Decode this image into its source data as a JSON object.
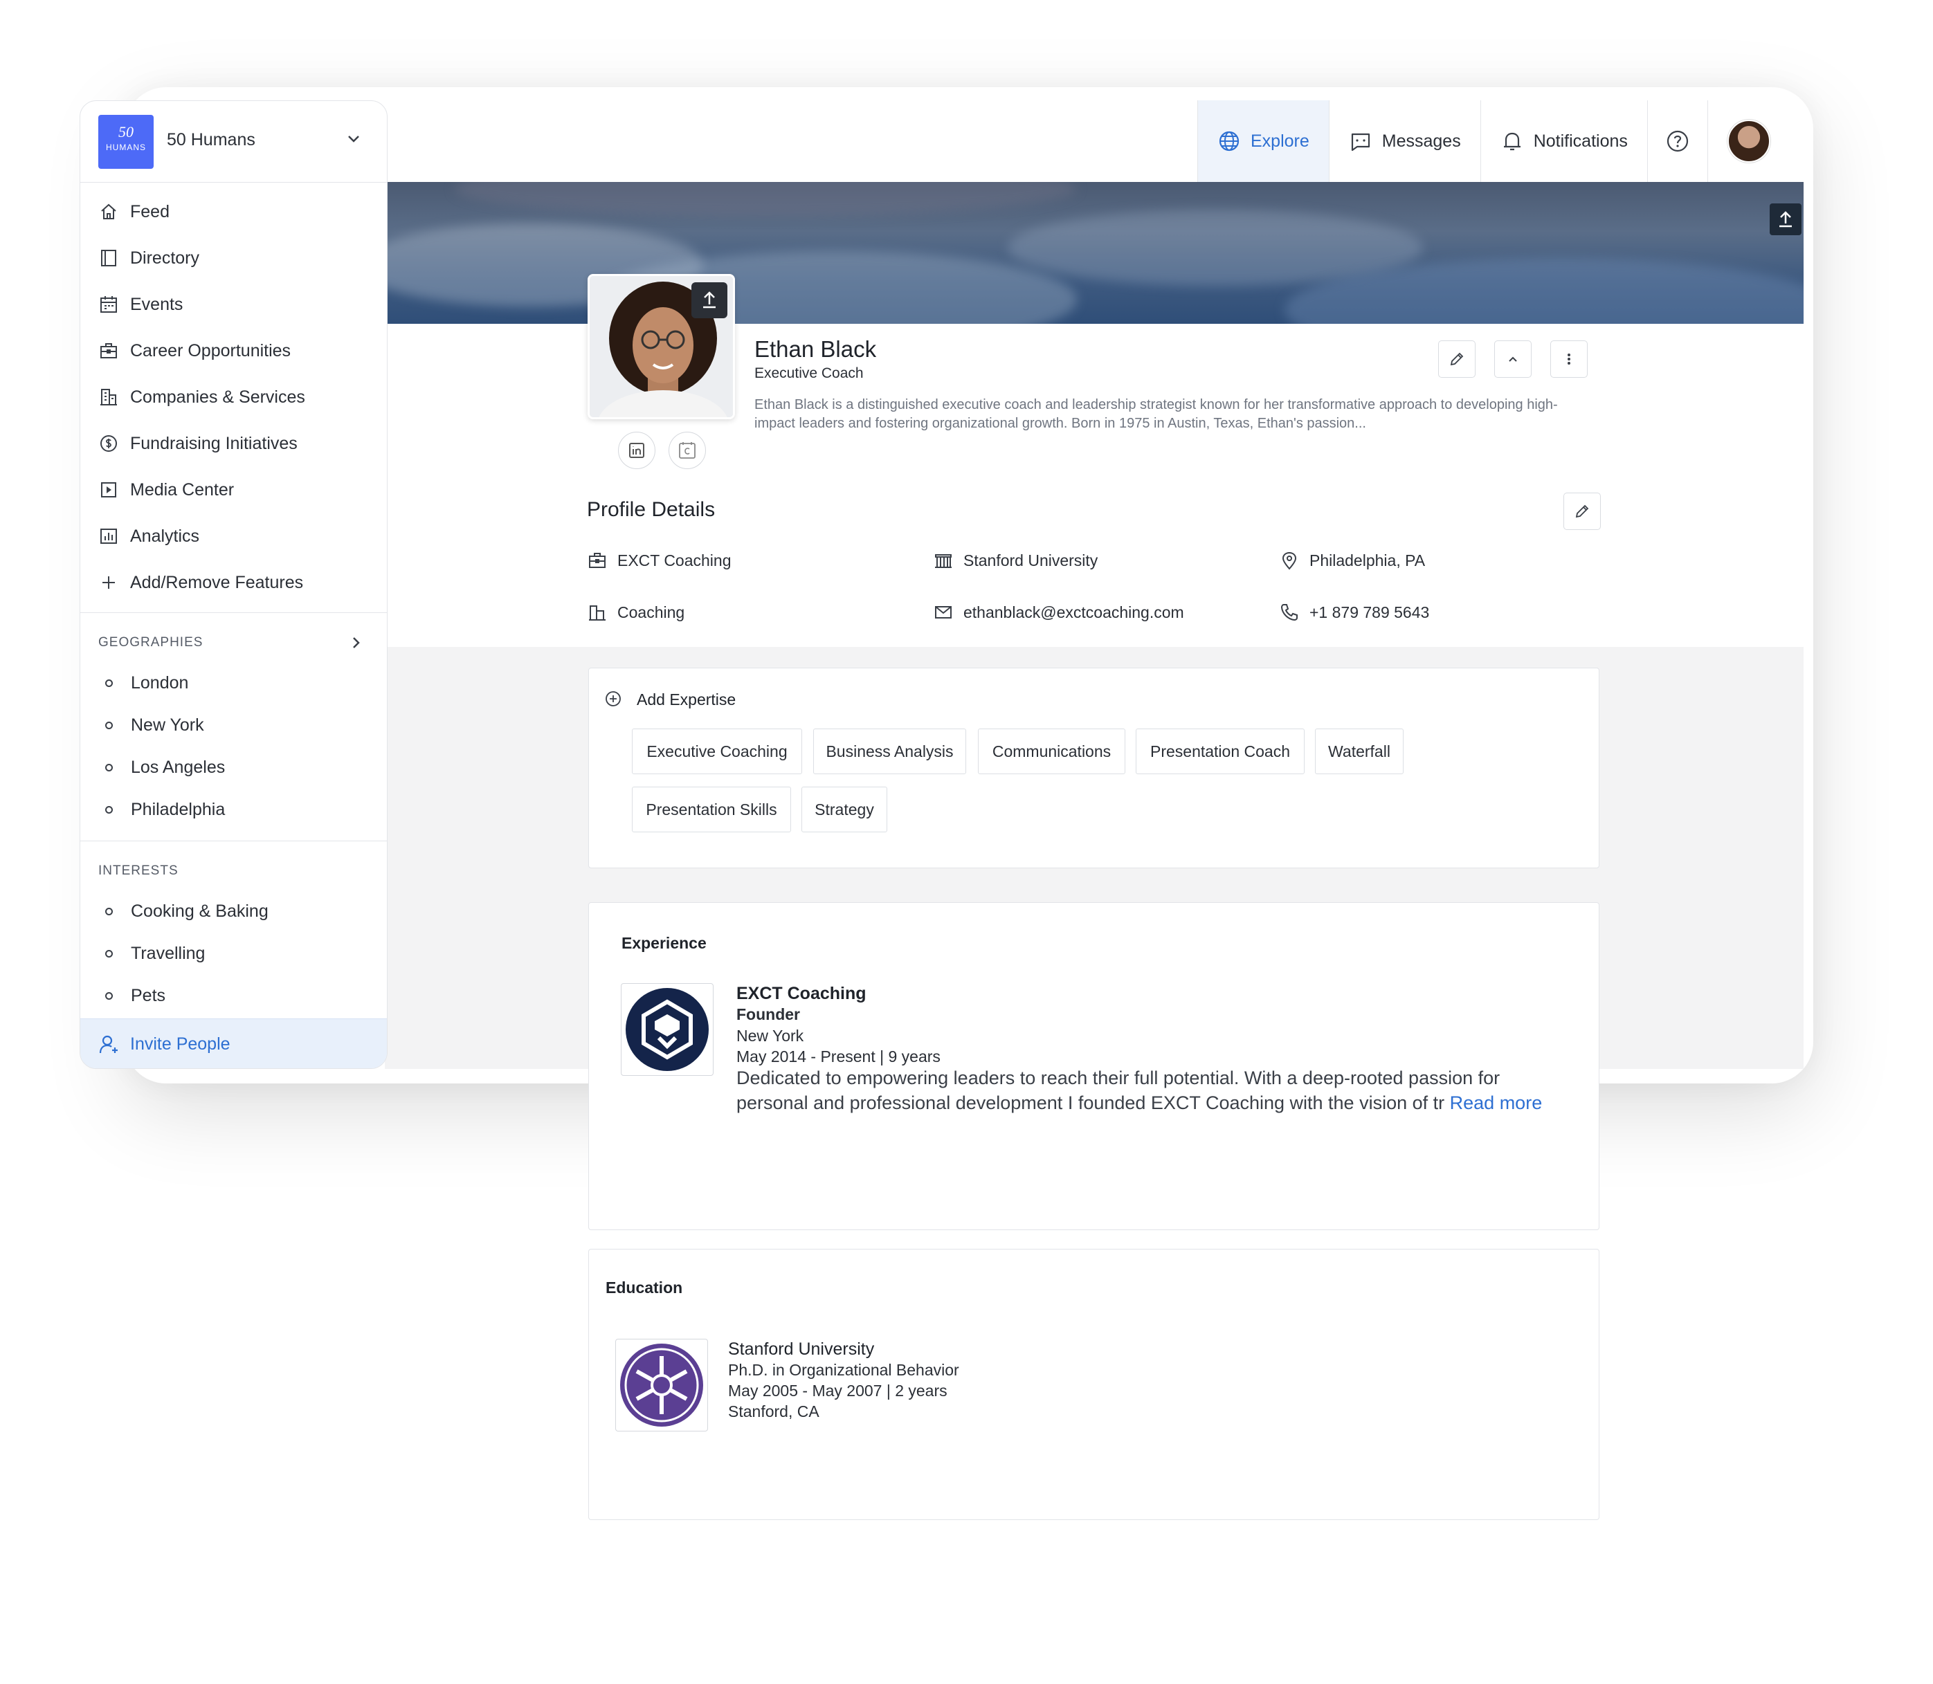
{
  "org": {
    "logo_top": "50",
    "logo_bottom": "HUMANS",
    "name": "50 Humans"
  },
  "sidebar": {
    "nav": [
      {
        "label": "Feed",
        "icon": "home-icon"
      },
      {
        "label": "Directory",
        "icon": "book-icon"
      },
      {
        "label": "Events",
        "icon": "calendar-icon"
      },
      {
        "label": "Career Opportunities",
        "icon": "briefcase-icon"
      },
      {
        "label": "Companies & Services",
        "icon": "building-icon"
      },
      {
        "label": "Fundraising Initiatives",
        "icon": "dollar-circle-icon"
      },
      {
        "label": "Media Center",
        "icon": "play-square-icon"
      },
      {
        "label": "Analytics",
        "icon": "bar-chart-icon"
      },
      {
        "label": "Add/Remove Features",
        "icon": "plus-icon"
      }
    ],
    "geographies_title": "GEOGRAPHIES",
    "geographies": [
      "London",
      "New York",
      "Los Angeles",
      "Philadelphia"
    ],
    "interests_title": "INTERESTS",
    "interests": [
      "Cooking & Baking",
      "Travelling",
      "Pets"
    ],
    "invite_label": "Invite People"
  },
  "topnav": {
    "explore": "Explore",
    "messages": "Messages",
    "notifications": "Notifications"
  },
  "profile": {
    "name": "Ethan Black",
    "title": "Executive Coach",
    "bio": "Ethan Black is a distinguished executive coach and leadership strategist known for her transformative approach to developing high-impact leaders and fostering organizational growth. Born in 1975 in Austin, Texas, Ethan's passion...",
    "details_title": "Profile Details",
    "details": {
      "company": "EXCT Coaching",
      "school": "Stanford University",
      "location": "Philadelphia, PA",
      "industry": "Coaching",
      "email": "ethanblack@exctcoaching.com",
      "phone": "+1 879 789 5643"
    }
  },
  "expertise": {
    "add_label": "Add Expertise",
    "chips": [
      "Executive Coaching",
      "Business Analysis",
      "Communications",
      "Presentation Coach",
      "Waterfall",
      "Presentation Skills",
      "Strategy"
    ]
  },
  "experience": {
    "title": "Experience",
    "company": "EXCT Coaching",
    "role": "Founder",
    "location": "New York",
    "dates": "May 2014 - Present | 9 years",
    "desc_line1": "Dedicated to empowering leaders to reach their full potential. With a deep-rooted passion for",
    "desc_line2": "personal and professional development  I founded EXCT Coaching with the vision of tr",
    "read_more": "Read more"
  },
  "education": {
    "title": "Education",
    "school": "Stanford University",
    "degree": "Ph.D. in Organizational Behavior",
    "dates": "May 2005 - May 2007 | 2 years",
    "location": "Stanford, CA"
  },
  "colors": {
    "accent": "#2d6fd2",
    "logo_bg": "#4d6af7",
    "exct_navy": "#14244a",
    "stanford_purple": "#5b3f93"
  }
}
